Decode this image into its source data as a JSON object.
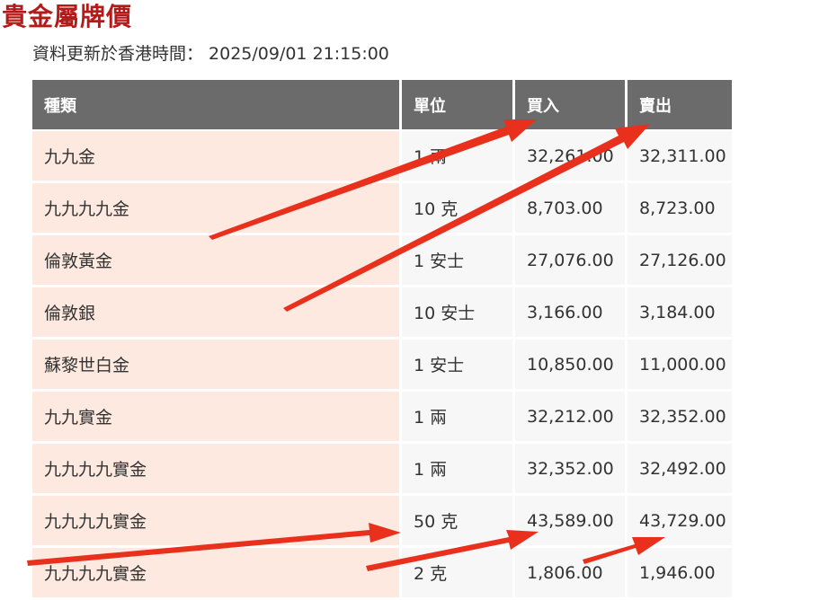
{
  "page": {
    "title": "貴金屬牌價",
    "update_label": "資料更新於香港時間：",
    "update_time": "2025/09/01 21:15:00"
  },
  "table": {
    "headers": [
      "種類",
      "單位",
      "買入",
      "賣出"
    ],
    "rows": [
      {
        "type": "九九金",
        "unit": "1 兩",
        "buy": "32,261.00",
        "sell": "32,311.00"
      },
      {
        "type": "九九九九金",
        "unit": "10 克",
        "buy": "8,703.00",
        "sell": "8,723.00"
      },
      {
        "type": "倫敦黃金",
        "unit": "1 安士",
        "buy": "27,076.00",
        "sell": "27,126.00"
      },
      {
        "type": "倫敦銀",
        "unit": "10 安士",
        "buy": "3,166.00",
        "sell": "3,184.00"
      },
      {
        "type": "蘇黎世白金",
        "unit": "1 安士",
        "buy": "10,850.00",
        "sell": "11,000.00"
      },
      {
        "type": "九九實金",
        "unit": "1 兩",
        "buy": "32,212.00",
        "sell": "32,352.00"
      },
      {
        "type": "九九九九實金",
        "unit": "1 兩",
        "buy": "32,352.00",
        "sell": "32,492.00"
      },
      {
        "type": "九九九九實金",
        "unit": "50 克",
        "buy": "43,589.00",
        "sell": "43,729.00"
      },
      {
        "type": "九九九九實金",
        "unit": "2 克",
        "buy": "1,806.00",
        "sell": "1,946.00"
      }
    ]
  },
  "annotations": {
    "arrow_color": "#e8301c"
  }
}
